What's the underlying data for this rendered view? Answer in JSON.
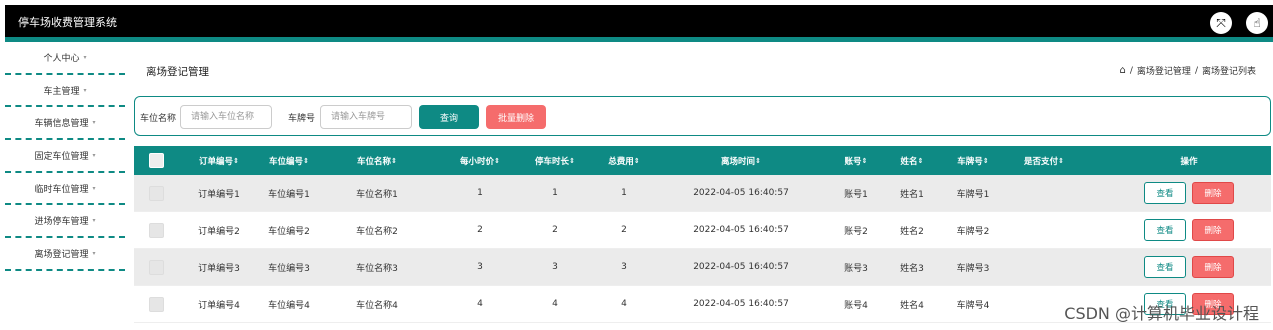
{
  "app": {
    "title": "停车场收费管理系统"
  },
  "topbar": {
    "fullscreen_icon": "expand-icon",
    "user_icon": "hand-pointer-icon"
  },
  "sidebar": {
    "items": [
      {
        "label": "个人中心"
      },
      {
        "label": "车主管理"
      },
      {
        "label": "车辆信息管理"
      },
      {
        "label": "固定车位管理"
      },
      {
        "label": "临时车位管理"
      },
      {
        "label": "进场停车管理"
      },
      {
        "label": "离场登记管理"
      }
    ],
    "caret": "▾"
  },
  "page": {
    "title": "离场登记管理",
    "breadcrumb": [
      "离场登记管理",
      "离场登记列表"
    ],
    "breadcrumb_sep": "/"
  },
  "search": {
    "slot_label": "车位名称",
    "slot_placeholder": "请输入车位名称",
    "plate_label": "车牌号",
    "plate_placeholder": "请输入车牌号",
    "query_button": "查询",
    "bulk_delete_button": "批量删除"
  },
  "table": {
    "headers": [
      "订单编号",
      "车位编号",
      "车位名称",
      "每小时价",
      "停车时长",
      "总费用",
      "离场时间",
      "账号",
      "姓名",
      "车牌号",
      "是否支付",
      "操作"
    ],
    "sort_glyph": "⇕",
    "rows": [
      [
        "订单编号1",
        "车位编号1",
        "车位名称1",
        "1",
        "1",
        "1",
        "2022-04-05 16:40:57",
        "账号1",
        "姓名1",
        "车牌号1",
        ""
      ],
      [
        "订单编号2",
        "车位编号2",
        "车位名称2",
        "2",
        "2",
        "2",
        "2022-04-05 16:40:57",
        "账号2",
        "姓名2",
        "车牌号2",
        ""
      ],
      [
        "订单编号3",
        "车位编号3",
        "车位名称3",
        "3",
        "3",
        "3",
        "2022-04-05 16:40:57",
        "账号3",
        "姓名3",
        "车牌号3",
        ""
      ],
      [
        "订单编号4",
        "车位编号4",
        "车位名称4",
        "4",
        "4",
        "4",
        "2022-04-05 16:40:57",
        "账号4",
        "姓名4",
        "车牌号4",
        ""
      ]
    ],
    "view_label": "查看",
    "delete_label": "删除"
  },
  "watermark": "CSDN @计算机毕业设计程",
  "colors": {
    "accent": "#0e8a84",
    "danger": "#f56c6c",
    "topbar": "#000000"
  }
}
